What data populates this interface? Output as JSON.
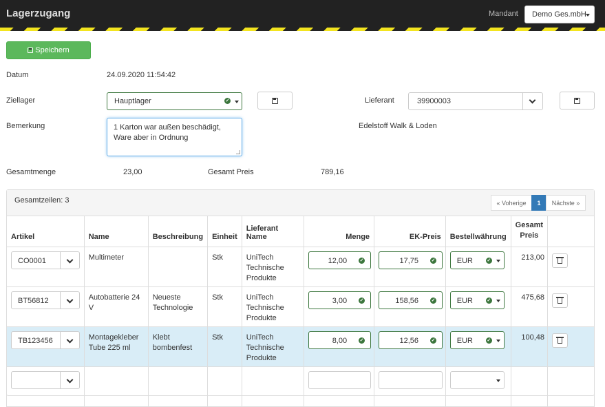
{
  "header": {
    "title": "Lagerzugang",
    "mandant_label": "Mandant",
    "tenant": "Demo Ges.mbH"
  },
  "toolbar": {
    "save_label": "Speichern"
  },
  "form": {
    "datum_label": "Datum",
    "datum_value": "24.09.2020 11:54:42",
    "ziellager_label": "Ziellager",
    "ziellager_value": "Hauptlager",
    "bemerkung_label": "Bemerkung",
    "bemerkung_value": "1 Karton war außen beschädigt, Ware aber in Ordnung",
    "lieferant_label": "Lieferant",
    "lieferant_value": "39900003",
    "lieferant_name": "Edelstoff Walk & Loden",
    "gesamtmenge_label": "Gesamtmenge",
    "gesamtmenge_value": "23,00",
    "gesamtpreis_label": "Gesamt Preis",
    "gesamtpreis_value": "789,16"
  },
  "panel": {
    "count_label": "Gesamtzeilen: 3",
    "prev_label": "« Voherige",
    "page": "1",
    "next_label": "Nächste »"
  },
  "table": {
    "columns": [
      "Artikel",
      "Name",
      "Beschreibung",
      "Einheit",
      "Lieferant Name",
      "Menge",
      "EK-Preis",
      "Bestellwährung",
      "Gesamt Preis"
    ],
    "rows": [
      {
        "artikel": "CO0001",
        "name": "Multimeter",
        "beschreibung": "",
        "einheit": "Stk",
        "lieferant": "UniTech Technische Produkte",
        "menge": "12,00",
        "ek_preis": "17,75",
        "waehrung": "EUR",
        "gesamt": "213,00"
      },
      {
        "artikel": "BT56812",
        "name": "Autobatterie 24 V",
        "beschreibung": "Neueste Technologie",
        "einheit": "Stk",
        "lieferant": "UniTech Technische Produkte",
        "menge": "3,00",
        "ek_preis": "158,56",
        "waehrung": "EUR",
        "gesamt": "475,68"
      },
      {
        "artikel": "TB123456",
        "name": "Montagekleber Tube 225 ml",
        "beschreibung": "Klebt bombenfest",
        "einheit": "Stk",
        "lieferant": "UniTech Technische Produkte",
        "menge": "8,00",
        "ek_preis": "12,56",
        "waehrung": "EUR",
        "gesamt": "100,48"
      }
    ]
  },
  "icons": {
    "save": "floppy-disk-icon",
    "valid": "check-circle-icon",
    "dropdown": "chevron-down-icon",
    "delete": "trash-icon"
  },
  "colors": {
    "topbar": "#222222",
    "stripe_yellow": "#f3e41f",
    "save_button": "#5cb85c",
    "valid_green": "#3c763d",
    "selected_row": "#d9edf7",
    "active_page": "#337ab7"
  }
}
